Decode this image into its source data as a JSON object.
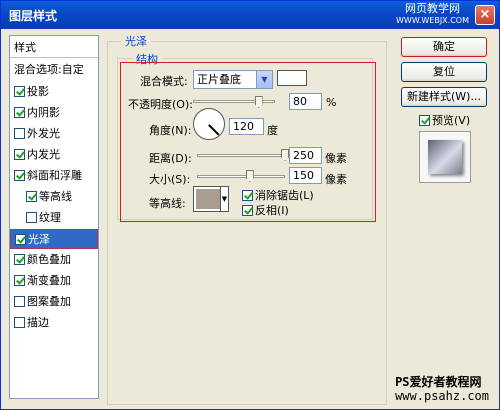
{
  "window": {
    "title": "图层样式",
    "close": "×"
  },
  "watermark_top": {
    "line1": "网页教学网",
    "line2": "WWW.WEBJX.COM"
  },
  "sidebar": {
    "header": "样式",
    "blend": "混合选项:自定",
    "items": [
      {
        "label": "投影",
        "checked": true
      },
      {
        "label": "内阴影",
        "checked": true
      },
      {
        "label": "外发光",
        "checked": false
      },
      {
        "label": "内发光",
        "checked": true
      },
      {
        "label": "斜面和浮雕",
        "checked": true
      },
      {
        "label": "等高线",
        "checked": true,
        "indent": true
      },
      {
        "label": "纹理",
        "checked": false,
        "indent": true
      },
      {
        "label": "光泽",
        "checked": true,
        "selected": true
      },
      {
        "label": "颜色叠加",
        "checked": true
      },
      {
        "label": "渐变叠加",
        "checked": true
      },
      {
        "label": "图案叠加",
        "checked": false
      },
      {
        "label": "描边",
        "checked": false
      }
    ]
  },
  "panel": {
    "group_title": "光泽",
    "sub_title": "结构",
    "blend_mode_label": "混合模式:",
    "blend_mode_value": "正片叠底",
    "opacity_label": "不透明度(O):",
    "opacity_value": "80",
    "opacity_unit": "%",
    "opacity_level": 0.8,
    "angle_label": "角度(N):",
    "angle_value": "120",
    "angle_unit": "度",
    "distance_label": "距离(D):",
    "distance_value": "250",
    "distance_unit": "像素",
    "distance_level": 1.0,
    "size_label": "大小(S):",
    "size_value": "150",
    "size_unit": "像素",
    "size_level": 0.6,
    "contour_label": "等高线:",
    "antialias_label": "消除锯齿(L)",
    "antialias_checked": true,
    "invert_label": "反相(I)",
    "invert_checked": true
  },
  "buttons": {
    "ok": "确定",
    "reset": "复位",
    "new_style": "新建样式(W)...",
    "preview": "预览(V)",
    "preview_checked": true
  },
  "watermark_bottom": {
    "line1": "PS爱好者教程网",
    "line2": "www.psahz.com"
  }
}
